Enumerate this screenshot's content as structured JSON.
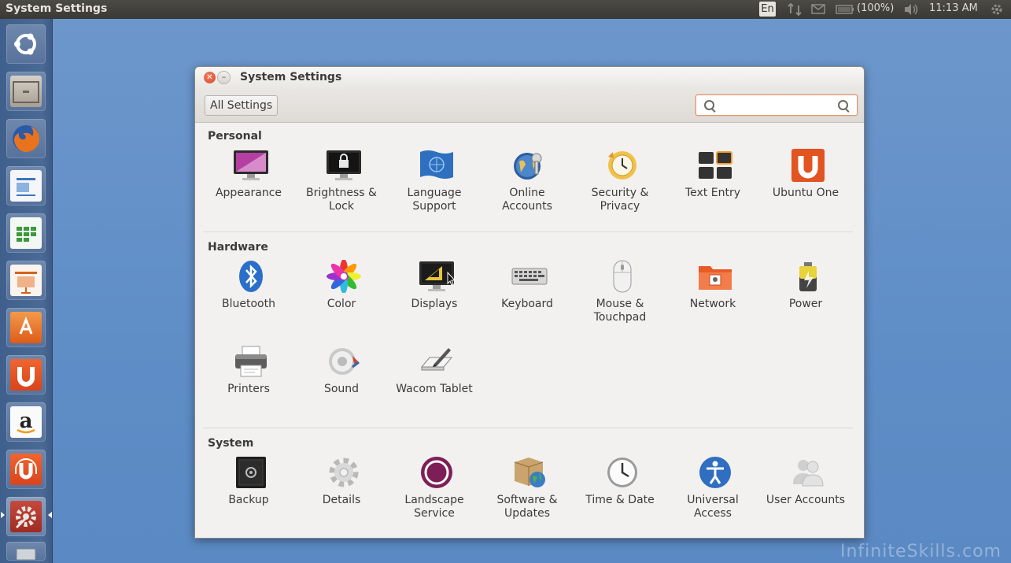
{
  "top_panel": {
    "app_title": "System Settings",
    "keyboard_layout": "En",
    "battery": "(100%)",
    "clock": "11:13 AM"
  },
  "window": {
    "title": "System Settings",
    "all_settings_label": "All Settings",
    "search_placeholder": ""
  },
  "sections": {
    "personal": {
      "title": "Personal",
      "items": [
        {
          "label": "Appearance"
        },
        {
          "label": "Brightness &\nLock"
        },
        {
          "label": "Language\nSupport"
        },
        {
          "label": "Online\nAccounts"
        },
        {
          "label": "Security &\nPrivacy"
        },
        {
          "label": "Text Entry"
        },
        {
          "label": "Ubuntu One"
        }
      ]
    },
    "hardware": {
      "title": "Hardware",
      "items": [
        {
          "label": "Bluetooth"
        },
        {
          "label": "Color"
        },
        {
          "label": "Displays"
        },
        {
          "label": "Keyboard"
        },
        {
          "label": "Mouse &\nTouchpad"
        },
        {
          "label": "Network"
        },
        {
          "label": "Power"
        },
        {
          "label": "Printers"
        },
        {
          "label": "Sound"
        },
        {
          "label": "Wacom Tablet"
        }
      ]
    },
    "system": {
      "title": "System",
      "items": [
        {
          "label": "Backup"
        },
        {
          "label": "Details"
        },
        {
          "label": "Landscape\nService"
        },
        {
          "label": "Software &\nUpdates"
        },
        {
          "label": "Time & Date"
        },
        {
          "label": "Universal\nAccess"
        },
        {
          "label": "User Accounts"
        }
      ]
    }
  },
  "watermark": "InfiniteSkills.com",
  "colors": {
    "accent_orange": "#e05d2b",
    "desktop_blue": "#5e8cc4",
    "panel_dark": "#3c3b37",
    "aubergine": "#7e1e57"
  }
}
